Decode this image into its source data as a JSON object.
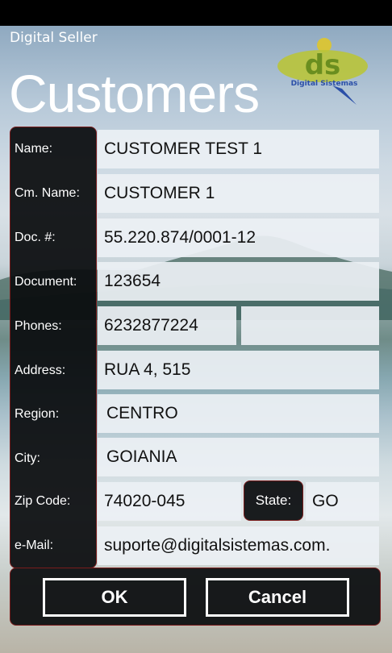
{
  "app": {
    "name": "Digital Seller",
    "page_title": "Customers"
  },
  "logo": {
    "text": "Digital Sistemas",
    "icon": "ds-logo"
  },
  "labels": {
    "name": "Name:",
    "cm_name": "Cm. Name:",
    "doc": "Doc. #:",
    "document": "Document:",
    "phones": "Phones:",
    "address": "Address:",
    "region": "Region:",
    "city": "City:",
    "zip": "Zip Code:",
    "state": "State:",
    "email": "e-Mail:"
  },
  "fields": {
    "name": "CUSTOMER TEST 1",
    "cm_name": "CUSTOMER 1",
    "doc": "55.220.874/0001-12",
    "document": "123654",
    "phone1": "6232877224",
    "phone2": "",
    "address": "RUA 4, 515",
    "region": "CENTRO",
    "city": "GOIANIA",
    "zip": "74020-045",
    "state": "GO",
    "email": "suporte@digitalsistemas.com."
  },
  "buttons": {
    "ok": "OK",
    "cancel": "Cancel"
  },
  "colors": {
    "panel": "#0a0c0e",
    "panel_border": "#7a1c1c",
    "field_bg": "#ecf0f4"
  }
}
